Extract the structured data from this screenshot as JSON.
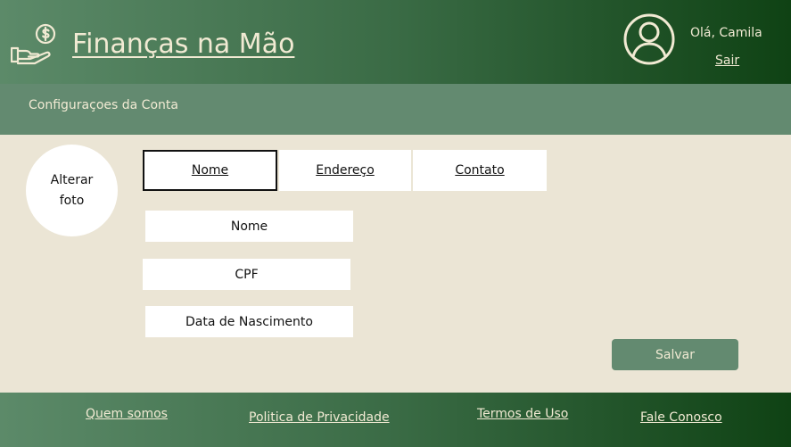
{
  "colors": {
    "header_gradient_start": "#5c8a69",
    "header_gradient_end": "#0f4214",
    "accent": "#638a70",
    "background": "#ebe5d5",
    "light_text": "#f1ead3"
  },
  "header": {
    "logo_icon": "money-hand-icon",
    "brand": "Finanças na Mão",
    "avatar_icon": "user-circle-icon",
    "greeting": "Olá, Camila",
    "logout": "Sair"
  },
  "subheader": {
    "title": "Configuraçoes da Conta"
  },
  "profile": {
    "change_photo": "Alterar foto"
  },
  "tabs": [
    {
      "label": "Nome",
      "selected": true
    },
    {
      "label": "Endereço",
      "selected": false
    },
    {
      "label": "Contato",
      "selected": false
    }
  ],
  "form": {
    "name_placeholder": "Nome",
    "cpf_placeholder": "CPF",
    "birthdate_placeholder": "Data de Nascimento",
    "save_label": "Salvar"
  },
  "footer": {
    "links": [
      "Quem somos",
      "Politica de Privacidade",
      "Termos de Uso",
      "Fale Conosco"
    ]
  }
}
